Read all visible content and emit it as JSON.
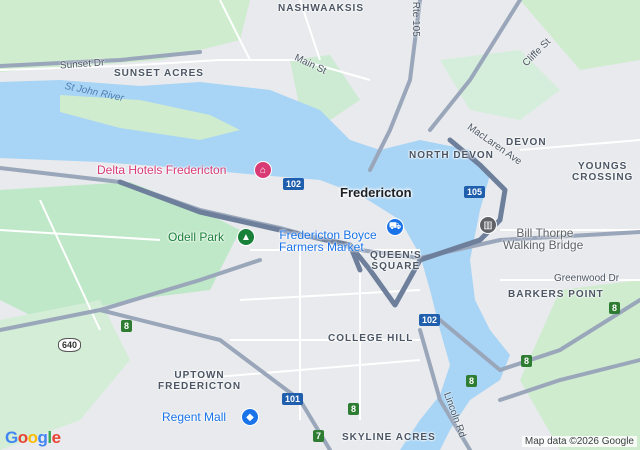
{
  "map": {
    "areas": [
      {
        "id": "nashwaaksis",
        "text": "NASHWAAKSIS"
      },
      {
        "id": "sunset-acres",
        "text": "SUNSET ACRES"
      },
      {
        "id": "devon",
        "text": "DEVON"
      },
      {
        "id": "north-devon",
        "text": "NORTH DEVON"
      },
      {
        "id": "youngs-crossing",
        "text": "YOUNGS\nCROSSING"
      },
      {
        "id": "queens-square",
        "text": "QUEEN'S\nSQUARE"
      },
      {
        "id": "barkers-point",
        "text": "BARKERS POINT"
      },
      {
        "id": "college-hill",
        "text": "COLLEGE HILL"
      },
      {
        "id": "uptown-fredericton",
        "text": "UPTOWN\nFREDERICTON"
      },
      {
        "id": "skyline-acres",
        "text": "SKYLINE ACRES"
      }
    ],
    "streets": [
      {
        "id": "sunset-dr",
        "text": "Sunset Dr"
      },
      {
        "id": "main-st",
        "text": "Main St"
      },
      {
        "id": "cliffe-st",
        "text": "Cliffe St"
      },
      {
        "id": "maclaren-ave",
        "text": "MacLaren Ave"
      },
      {
        "id": "greenwood-dr",
        "text": "Greenwood Dr"
      },
      {
        "id": "lincoln-rd",
        "text": "Lincoln Rd"
      },
      {
        "id": "rte-105",
        "text": "Rte 105"
      }
    ],
    "water": [
      {
        "id": "st-john-river",
        "text": "St John River"
      }
    ],
    "city": {
      "text": "Fredericton"
    },
    "pois": [
      {
        "id": "delta-hotels",
        "text": "Delta Hotels Fredericton",
        "icon": "hotel-icon",
        "color": "#d93c75"
      },
      {
        "id": "farmers-market",
        "text": "Fredericton Boyce\nFarmers Market",
        "icon": "shopping-cart-icon",
        "color": "#1a73e8"
      },
      {
        "id": "odell-park",
        "text": "Odell Park",
        "icon": "tree-icon",
        "color": "#188038"
      },
      {
        "id": "walking-bridge",
        "text": "Bill Thorpe\nWalking Bridge",
        "icon": "landmark-icon",
        "color": "#5f6368"
      },
      {
        "id": "regent-mall",
        "text": "Regent Mall",
        "icon": "shopping-bag-icon",
        "color": "#1a73e8"
      }
    ],
    "shields": [
      {
        "id": "r102-a",
        "text": "102",
        "kind": "blue"
      },
      {
        "id": "r102-b",
        "text": "102",
        "kind": "blue"
      },
      {
        "id": "r105",
        "text": "105",
        "kind": "blue"
      },
      {
        "id": "r101",
        "text": "101",
        "kind": "blue"
      },
      {
        "id": "r8-a",
        "text": "8",
        "kind": "green"
      },
      {
        "id": "r8-b",
        "text": "8",
        "kind": "green"
      },
      {
        "id": "r8-c",
        "text": "8",
        "kind": "green"
      },
      {
        "id": "r8-d",
        "text": "8",
        "kind": "green"
      },
      {
        "id": "r8-e",
        "text": "8",
        "kind": "green"
      },
      {
        "id": "r7",
        "text": "7",
        "kind": "green"
      },
      {
        "id": "r640",
        "text": "640",
        "kind": "white"
      }
    ],
    "logo": "Google",
    "attribution": "Map data ©2026 Google",
    "colors": {
      "water": "#a8d4f5",
      "park": "#bfe8c8",
      "land": "#e8eaed",
      "road": "#ffffff",
      "highway": "#8d9ab1",
      "route": "#6e7f9b"
    }
  }
}
